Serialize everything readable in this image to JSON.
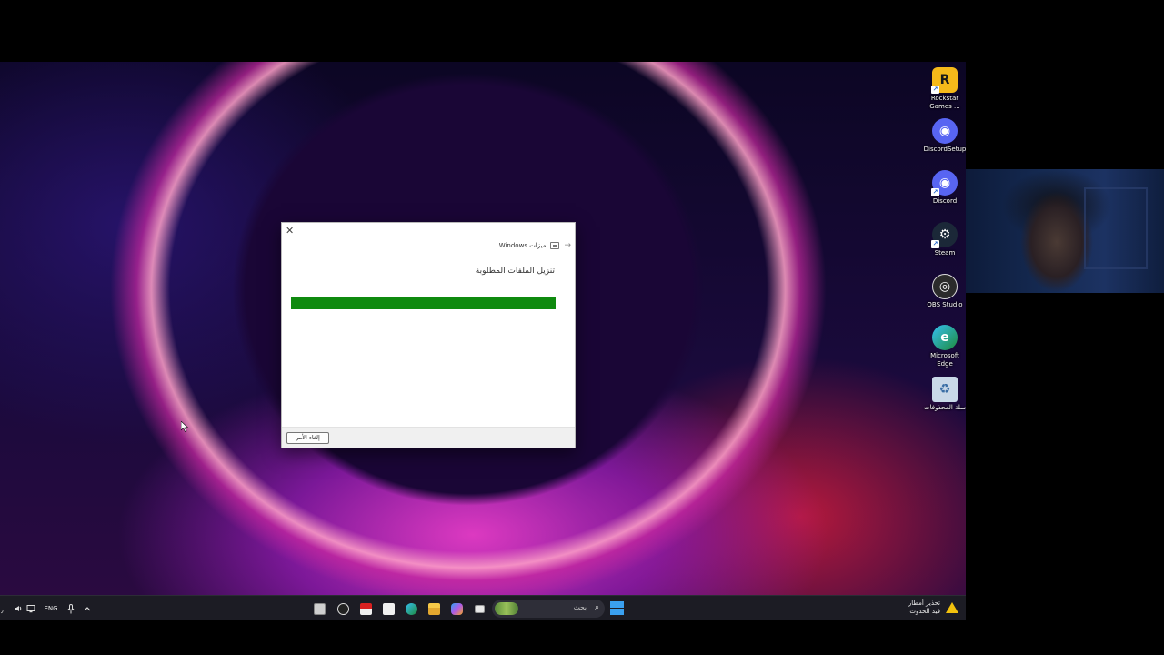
{
  "desktop_icons": [
    {
      "label": "Rockstar Games ...",
      "icon": "rockstar-icon",
      "color": "#f5b91a"
    },
    {
      "label": "DiscordSetup",
      "icon": "discord-icon",
      "color": "#5865f2"
    },
    {
      "label": "Discord",
      "icon": "discord-icon",
      "color": "#5865f2"
    },
    {
      "label": "Steam",
      "icon": "steam-icon",
      "color": "#1b2838"
    },
    {
      "label": "OBS Studio",
      "icon": "obs-icon",
      "color": "#2b2b2b"
    },
    {
      "label": "Microsoft Edge",
      "icon": "edge-icon",
      "color": "#1ea0c8"
    },
    {
      "label": "سلة المحذوفات",
      "icon": "recycle-bin-icon",
      "color": "#8fb4d8"
    }
  ],
  "dialog": {
    "app_title": "ميزات Windows",
    "heading": "تنزيل الملفات المطلوبة",
    "progress": 1.0,
    "progress_color": "#0f8a0f",
    "cancel_label": "إلغاء الأمر",
    "close_glyph": "✕",
    "back_glyph": "→"
  },
  "taskbar": {
    "language": "ENG",
    "search_placeholder": "بحث",
    "weather_line1": "تحذير أمطار",
    "weather_line2": "قيد الحدوث"
  }
}
